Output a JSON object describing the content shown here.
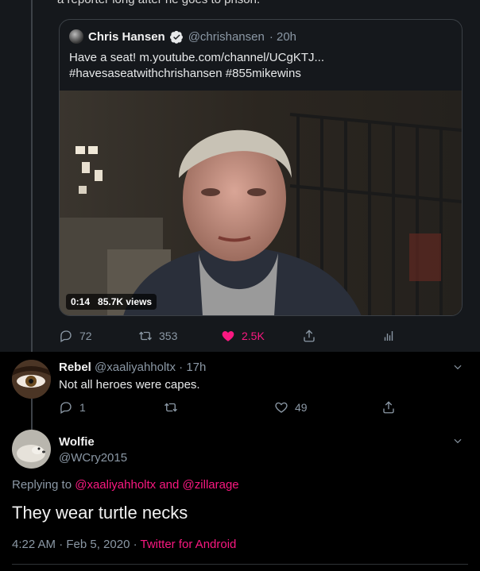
{
  "prev_tweet": {
    "cutoff_text": "a reporter long after he goes to prison."
  },
  "quote": {
    "name": "Chris Hansen",
    "handle": "@chrishansen",
    "time": "· 20h",
    "text_line1": "Have a seat! m.youtube.com/channel/UCgKTJ...",
    "text_line2": "#havesaseatwithchrishansen #855mikewins",
    "media": {
      "duration": "0:14",
      "views": "85.7K views"
    }
  },
  "main_actions": {
    "reply_count": "72",
    "retweet_count": "353",
    "like_count": "2.5K",
    "like_color": "#f91880"
  },
  "reply": {
    "name": "Rebel",
    "handle": "@xaaliyahholtx",
    "time": "· 17h",
    "text": "Not all heroes were capes.",
    "reply_count": "1",
    "retweet_count": "",
    "like_count": "49"
  },
  "focus": {
    "name": "Wolfie",
    "handle": "@WCry2015",
    "replying_prefix": "Replying to",
    "mention1": "@xaaliyahholtx",
    "and": "and",
    "mention2": "@zillarage",
    "text": "They wear turtle necks",
    "timestamp": "4:22 AM · Feb 5, 2020 ·",
    "source": "Twitter for Android"
  },
  "icons": [
    "verified-icon",
    "reply-icon",
    "retweet-icon",
    "like-icon",
    "share-icon",
    "analytics-icon",
    "chevron-down-icon"
  ],
  "colors": {
    "accent": "#f91880",
    "background": "#15181c",
    "muted": "#8b98a5"
  }
}
